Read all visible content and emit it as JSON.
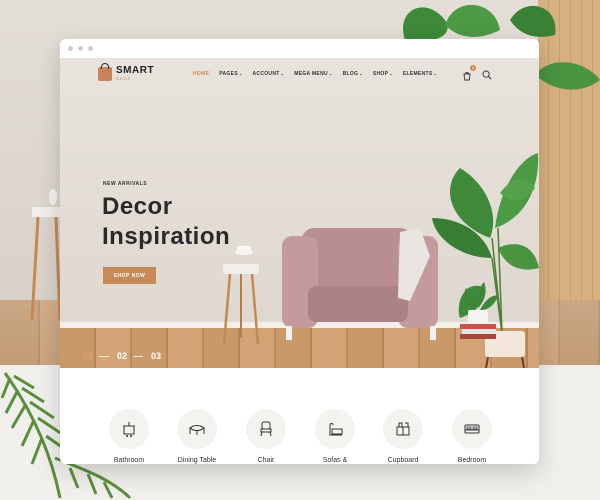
{
  "browser": {
    "window_dots": [
      "close",
      "minimize",
      "maximize"
    ]
  },
  "brand": {
    "name": "SMART",
    "tagline": "SHOP"
  },
  "menu": [
    {
      "label": "HOME",
      "active": true
    },
    {
      "label": "PAGES",
      "active": false
    },
    {
      "label": "ACCOUNT",
      "active": false
    },
    {
      "label": "MEGA MENU",
      "active": false
    },
    {
      "label": "BLOG",
      "active": false
    },
    {
      "label": "SHOP",
      "active": false
    },
    {
      "label": "ELEMENTS",
      "active": false
    }
  ],
  "caret": "⌄",
  "cart": {
    "count": "0",
    "icon": "cart-icon"
  },
  "search": {
    "icon": "search-icon"
  },
  "hero": {
    "eyebrow": "NEW ARRIVALS",
    "headline_line1": "Decor",
    "headline_line2": "Inspiration",
    "cta": "SHOP NOW",
    "slides": [
      "01",
      "02",
      "03"
    ],
    "active_slide": 0
  },
  "categories": [
    {
      "label": "Bathroom",
      "icon": "bathroom-icon"
    },
    {
      "label": "Dining Table",
      "icon": "dining-table-icon"
    },
    {
      "label": "Chair",
      "icon": "chair-icon"
    },
    {
      "label": "Sofas &",
      "icon": "sofa-icon"
    },
    {
      "label": "Cupboard",
      "icon": "cupboard-icon"
    },
    {
      "label": "Bedroom",
      "icon": "bed-icon"
    }
  ],
  "colors": {
    "accent": "#c98a5a",
    "active_menu": "#d0884f",
    "text_dark": "#2a2a2a"
  }
}
